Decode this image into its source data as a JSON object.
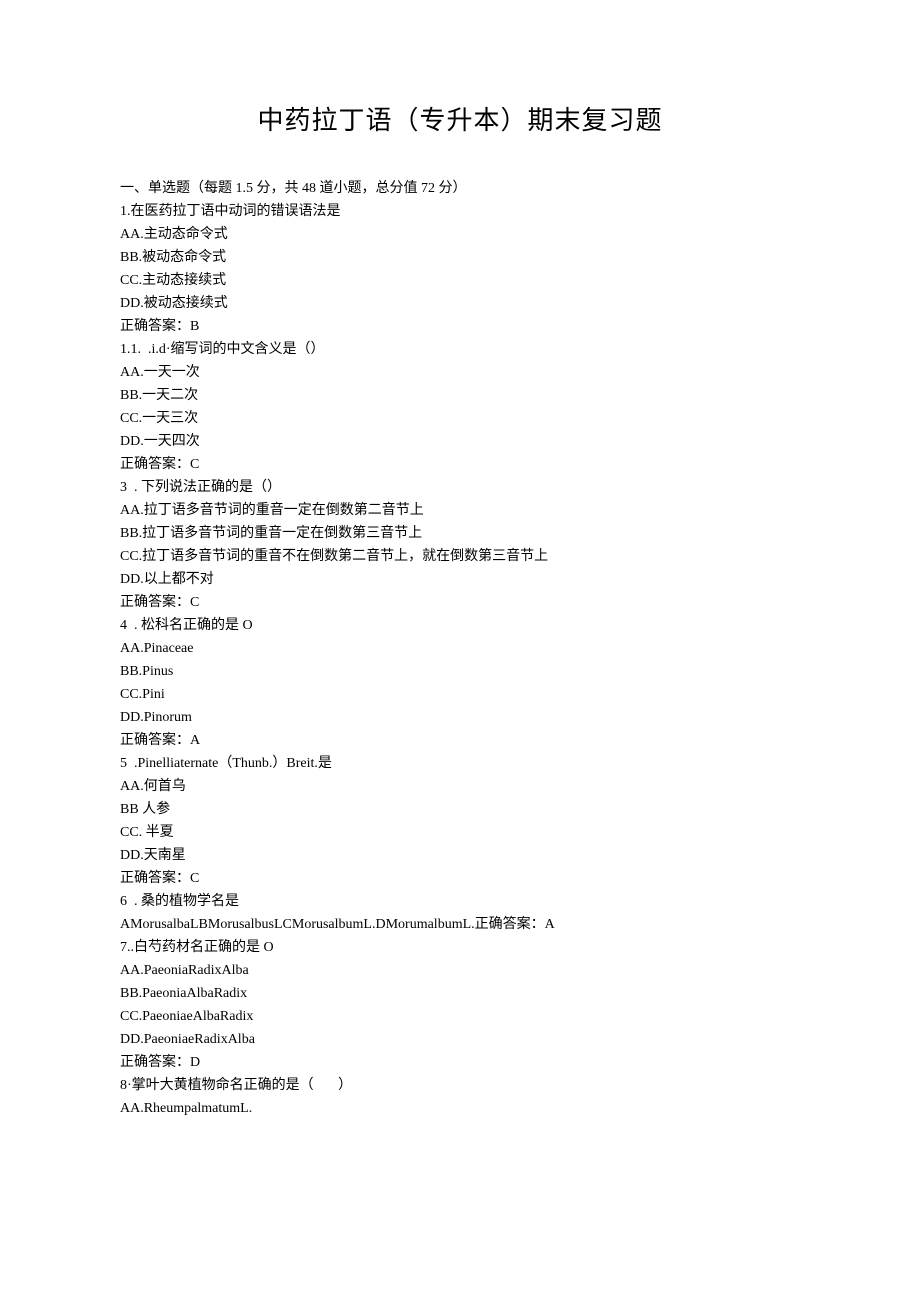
{
  "title": "中药拉丁语（专升本）期末复习题",
  "section_header": "一、单选题（每题 1.5 分，共 48 道小题，总分值 72 分）",
  "lines": [
    "1.在医药拉丁语中动词的错误语法是",
    "AA.主动态命令式",
    "BB.被动态命令式",
    "CC.主动态接续式",
    "DD.被动态接续式",
    "正确答案：B",
    "1.1.  .i.d·缩写词的中文含义是（）",
    "AA.一天一次",
    "BB.一天二次",
    "CC.一天三次",
    "DD.一天四次",
    "正确答案：C",
    "3  . 下列说法正确的是（）",
    "AA.拉丁语多音节词的重音一定在倒数第二音节上",
    "BB.拉丁语多音节词的重音一定在倒数第三音节上",
    "CC.拉丁语多音节词的重音不在倒数第二音节上，就在倒数第三音节上",
    "DD.以上都不对",
    "正确答案：C",
    "4  . 松科名正确的是 O",
    "AA.Pinaceae",
    "BB.Pinus",
    "CC.Pini",
    "DD.Pinorum",
    "正确答案：A",
    "5  .Pinelliaternate（Thunb.）Breit.是",
    "AA.何首乌",
    "BB 人参",
    "CC. 半夏",
    "DD.天南星",
    "正确答案：C",
    "6  . 桑的植物学名是",
    "AMorusalbaLBMorusalbusLCMorusalbumL.DMorumalbumL.正确答案：A",
    "7..白芍药材名正确的是 O",
    "AA.PaeoniaRadixAlba",
    "BB.PaeoniaAlbaRadix",
    "CC.PaeoniaeAlbaRadix",
    "DD.PaeoniaeRadixAlba",
    "正确答案：D",
    "8·掌叶大黄植物命名正确的是（       ）",
    "AA.RheumpalmatumL."
  ]
}
